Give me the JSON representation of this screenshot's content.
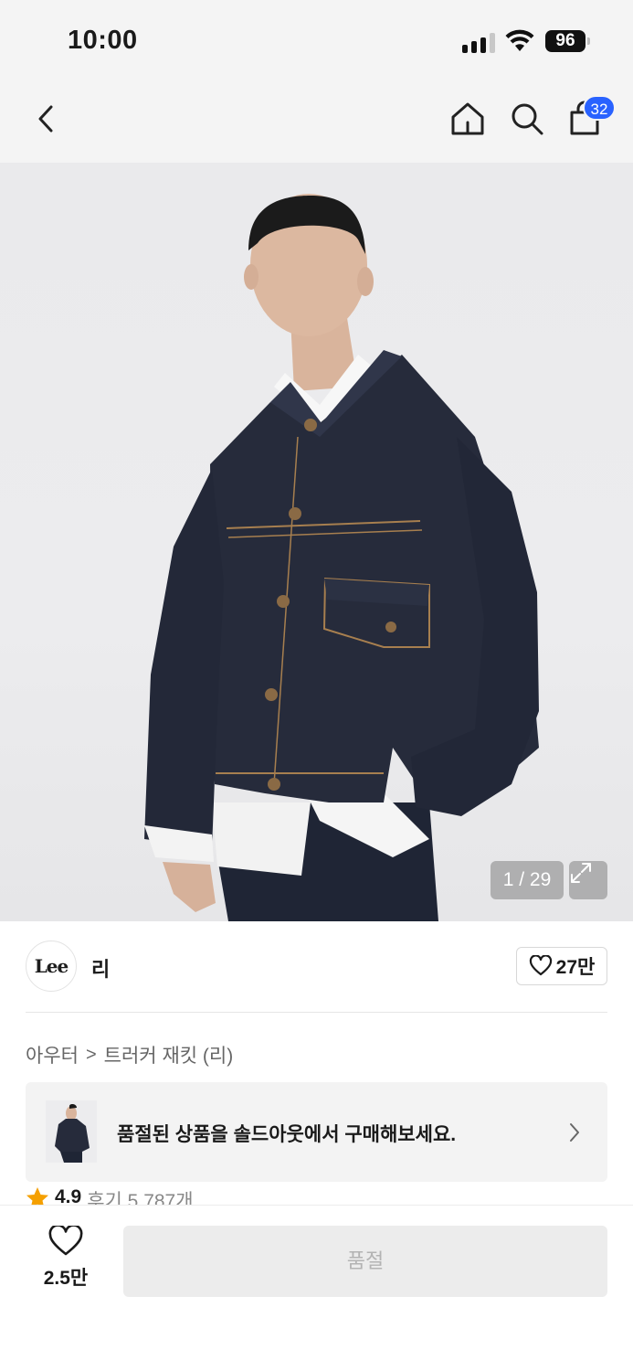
{
  "status_bar": {
    "time": "10:00",
    "battery": "96",
    "signal_bars_active": 3,
    "signal_bars_total": 4
  },
  "nav": {
    "cart_count": "32"
  },
  "gallery": {
    "counter": "1 / 29"
  },
  "brand": {
    "logo_text": "Lee",
    "name": "리",
    "likes": "27만"
  },
  "breadcrumb": {
    "category": "아우터",
    "separator": ">",
    "product": "트러커 재킷 (리)"
  },
  "soldout": {
    "message": "품절된 상품을 솔드아웃에서 구매해보세요."
  },
  "rating": {
    "score": "4.9",
    "reviews": "후기 5,787개"
  },
  "bottom": {
    "wish_count": "2.5만",
    "buy_label": "품절"
  },
  "colors": {
    "accent": "#2962ff",
    "star": "#f5a000",
    "denim": "#262b3b"
  }
}
